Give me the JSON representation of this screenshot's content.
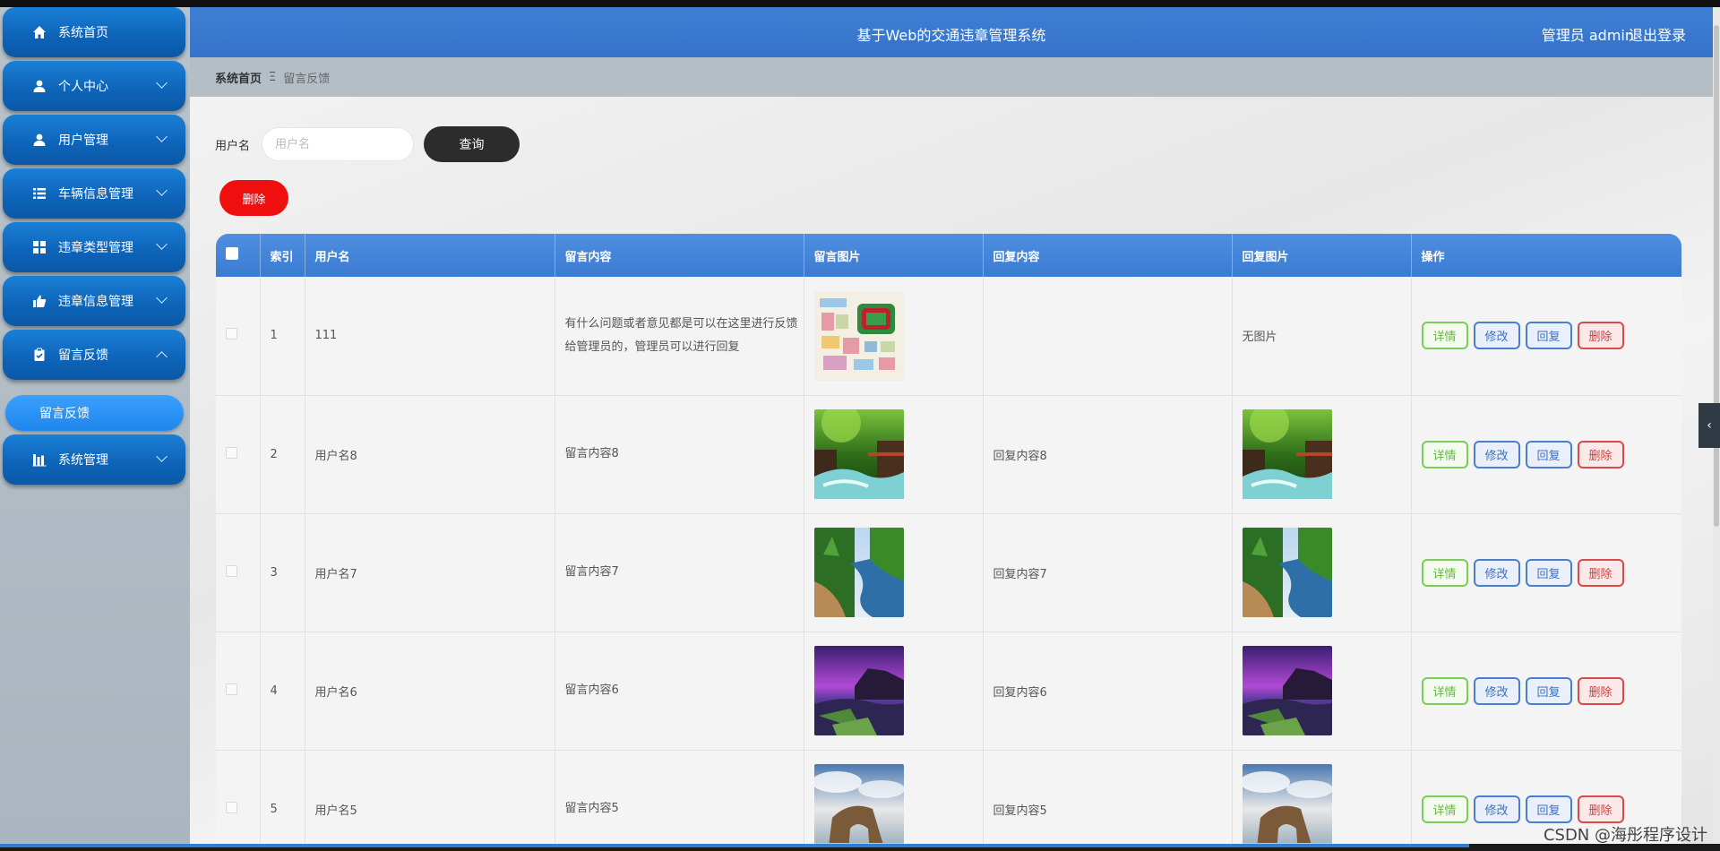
{
  "app": {
    "title": "基于Web的交通违章管理系统",
    "admin_label": "管理员 admin",
    "logout_label": "退出登录"
  },
  "sidebar": {
    "items": [
      {
        "label": "系统首页",
        "icon": "home-icon",
        "expandable": false
      },
      {
        "label": "个人中心",
        "icon": "user-icon",
        "expandable": true
      },
      {
        "label": "用户管理",
        "icon": "user-icon",
        "expandable": true
      },
      {
        "label": "车辆信息管理",
        "icon": "list-icon",
        "expandable": true
      },
      {
        "label": "违章类型管理",
        "icon": "grid-icon",
        "expandable": true
      },
      {
        "label": "违章信息管理",
        "icon": "thumb-icon",
        "expandable": true
      },
      {
        "label": "留言反馈",
        "icon": "clipboard-icon",
        "expandable": true,
        "expanded": true
      },
      {
        "label": "系统管理",
        "icon": "bar-chart-icon",
        "expandable": true
      }
    ],
    "sub_item": {
      "label": "留言反馈"
    }
  },
  "breadcrumb": {
    "home": "系统首页",
    "separator": "Ξ",
    "current": "留言反馈"
  },
  "search": {
    "label": "用户名",
    "placeholder": "用户名",
    "value": "",
    "button_label": "查询"
  },
  "batch_delete_label": "删除",
  "table": {
    "columns": [
      "索引",
      "用户名",
      "留言内容",
      "留言图片",
      "回复内容",
      "回复图片",
      "操作"
    ],
    "rows": [
      {
        "index": "1",
        "username": "111",
        "message": "有什么问题或者意见都是可以在这里进行反馈给管理员的，管理员可以进行回复",
        "message_image": "map",
        "reply": "",
        "reply_image_text": "无图片",
        "reply_image": null
      },
      {
        "index": "2",
        "username": "用户名8",
        "message": "留言内容8",
        "message_image": "waterfall",
        "reply": "回复内容8",
        "reply_image_text": "",
        "reply_image": "waterfall"
      },
      {
        "index": "3",
        "username": "用户名7",
        "message": "留言内容7",
        "message_image": "river",
        "reply": "回复内容7",
        "reply_image_text": "",
        "reply_image": "river"
      },
      {
        "index": "4",
        "username": "用户名6",
        "message": "留言内容6",
        "message_image": "coast",
        "reply": "回复内容6",
        "reply_image_text": "",
        "reply_image": "coast"
      },
      {
        "index": "5",
        "username": "用户名5",
        "message": "留言内容5",
        "message_image": "arch",
        "reply": "回复内容5",
        "reply_image_text": "",
        "reply_image": "arch"
      }
    ],
    "actions": {
      "detail": "详情",
      "edit": "修改",
      "reply": "回复",
      "delete": "删除"
    }
  },
  "watermark": "CSDN @海彤程序设计",
  "colors": {
    "header": "#3573c9",
    "menu": "#0d63b8",
    "query_button": "#2c2c2c",
    "delete_button": "#f00f0f"
  }
}
